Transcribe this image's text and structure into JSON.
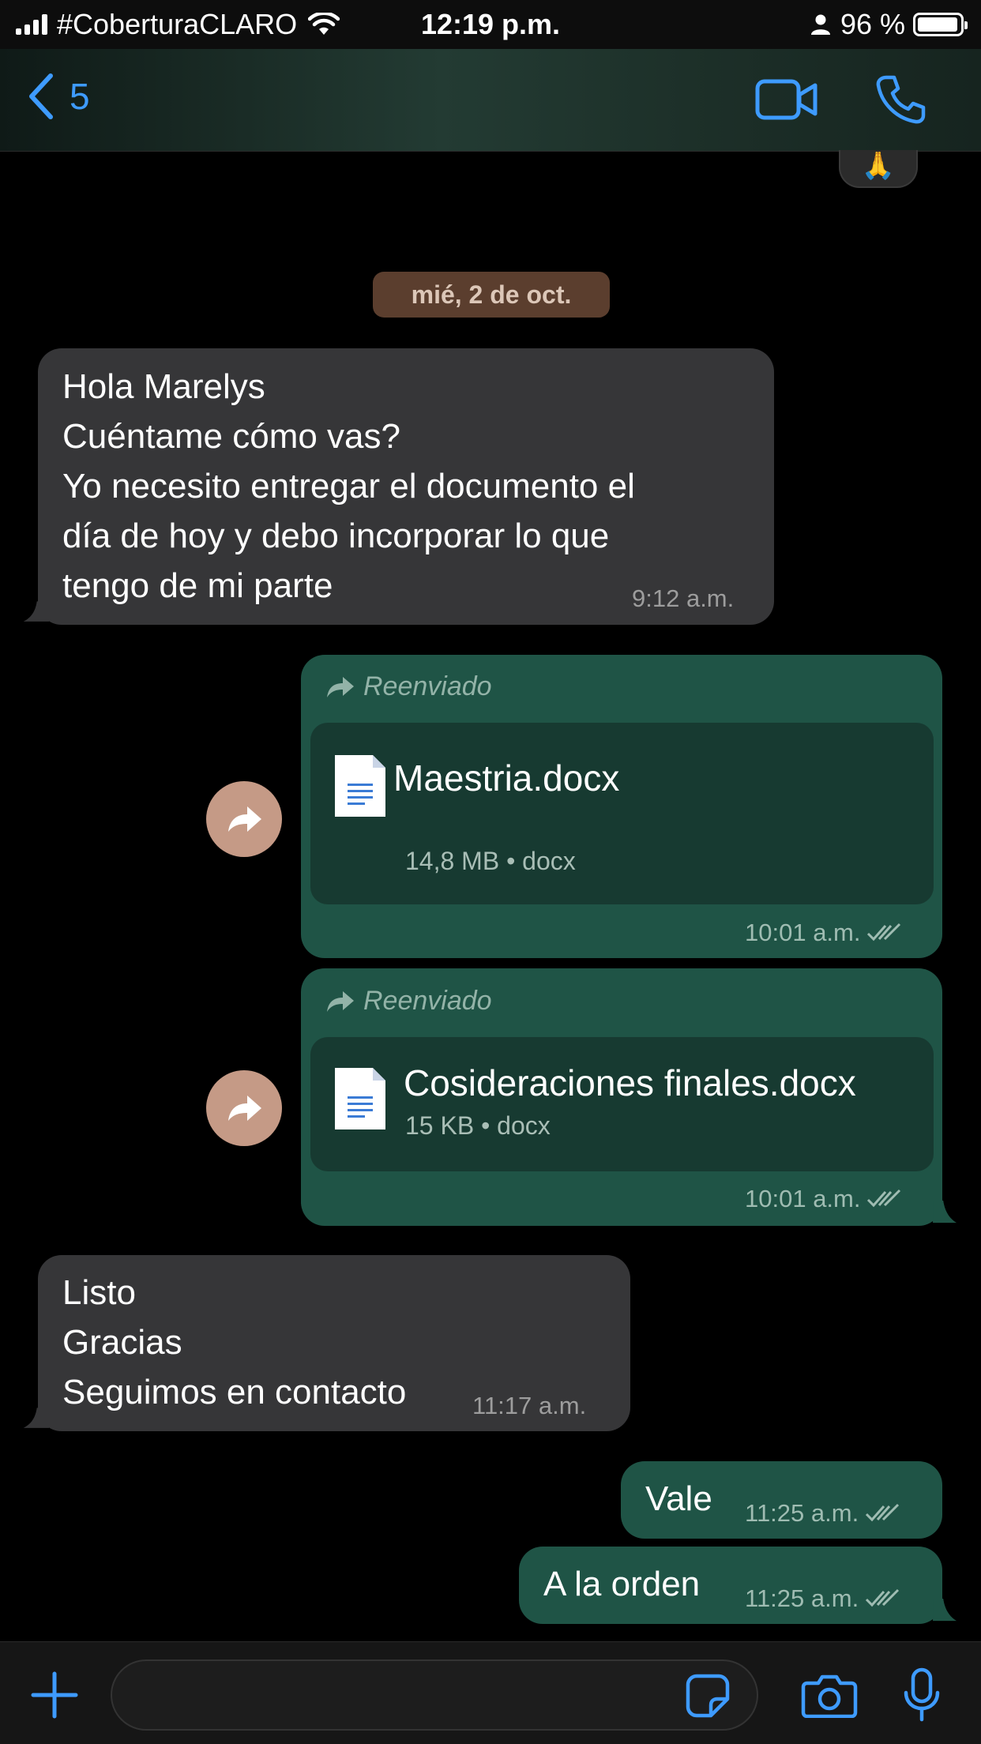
{
  "status_bar": {
    "carrier": "#CoberturaCLARO",
    "time": "12:19 p.m.",
    "battery": "96 %",
    "battery_level": 0.96
  },
  "header": {
    "back_count": "5"
  },
  "reaction": {
    "emoji": "🙏"
  },
  "date_separator": "mié, 2 de oct.",
  "messages": [
    {
      "direction": "in",
      "text": "Hola Marelys\nCuéntame cómo vas?\nYo necesito entregar el documento el\ndía de hoy y debo incorporar lo que\ntengo de mi parte",
      "time": "9:12 a.m."
    },
    {
      "direction": "out",
      "forwarded_label": "Reenviado",
      "file_name": "Maestria.docx",
      "file_meta": "14,8 MB • docx",
      "time": "10:01 a.m."
    },
    {
      "direction": "out",
      "forwarded_label": "Reenviado",
      "file_name": "Cosideraciones finales.docx",
      "file_meta": "15 KB • docx",
      "time": "10:01 a.m."
    },
    {
      "direction": "in",
      "text": "Listo\nGracias\nSeguimos en contacto",
      "time": "11:17 a.m."
    },
    {
      "direction": "out",
      "text": "Vale",
      "time": "11:25 a.m."
    },
    {
      "direction": "out",
      "text": "A la orden",
      "time": "11:25 a.m."
    }
  ],
  "colors": {
    "accent": "#3e9bff",
    "incoming_bubble": "#363638",
    "outgoing_bubble": "#1f5446",
    "date_chip": "#5b3e2e"
  }
}
